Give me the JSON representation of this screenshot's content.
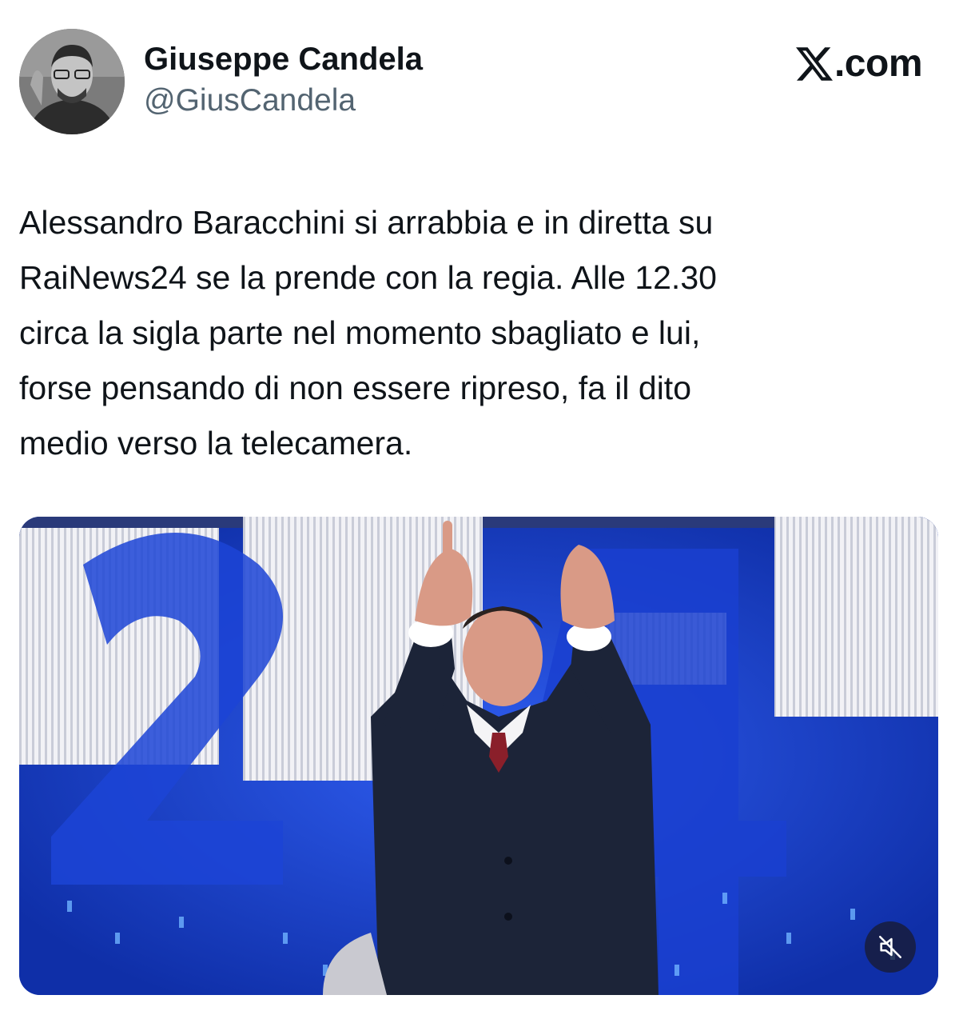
{
  "author": {
    "display_name": "Giuseppe Candela",
    "handle": "@GiusCandela",
    "avatar_icon": "profile-photo"
  },
  "brand": {
    "label": ".com",
    "logo_icon": "x-logo-icon"
  },
  "tweet": {
    "text": "Alessandro Baracchini si arrabbia e in diretta su\nRaiNews24 se la prende con la regia. Alle 12.30\ncirca la sigla parte nel momento sbagliato e lui,\nforse pensando di non essere ripreso, fa il dito\nmedio verso la telecamera."
  },
  "media": {
    "type": "video",
    "mute_icon": "muted-speaker-icon"
  },
  "colors": {
    "text": "#0f1419",
    "secondary_text": "#536471",
    "studio_blue": "#1238b8"
  }
}
